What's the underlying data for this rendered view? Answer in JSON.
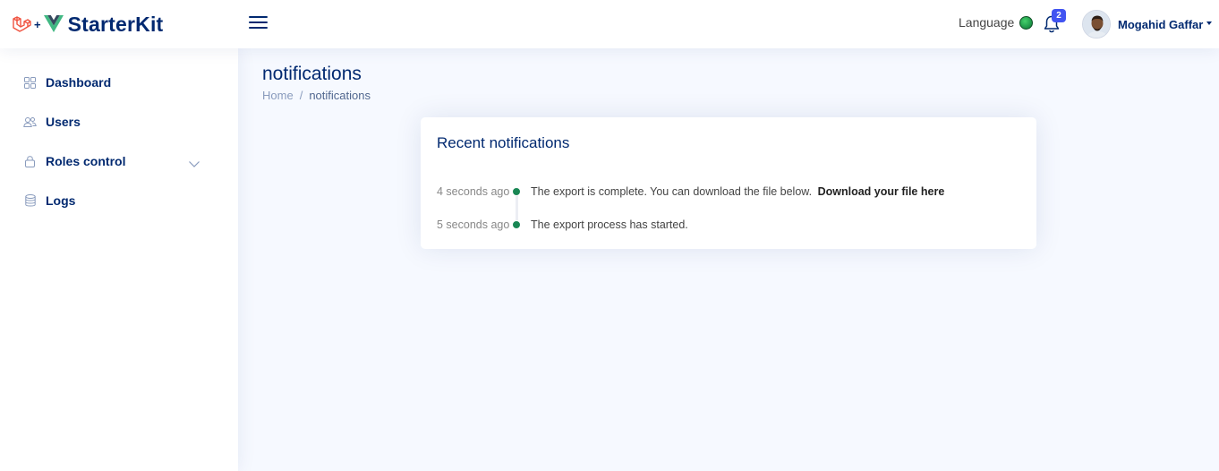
{
  "header": {
    "brand_plus": "+",
    "brand_name": "StarterKit",
    "language_label": "Language",
    "notification_count": "2",
    "user_name": "Mogahid Gaffar"
  },
  "sidebar": {
    "items": [
      {
        "label": "Dashboard",
        "icon": "grid-icon"
      },
      {
        "label": "Users",
        "icon": "people-icon"
      },
      {
        "label": "Roles control",
        "icon": "lock-icon"
      },
      {
        "label": "Logs",
        "icon": "database-icon"
      }
    ]
  },
  "main": {
    "title": "notifications",
    "breadcrumb": {
      "home": "Home",
      "separator": "/",
      "current": "notifications"
    },
    "card": {
      "title": "Recent notifications",
      "activities": [
        {
          "time": "4 seconds ago",
          "text": "The export is complete. You can download the file below.",
          "link": "Download your file here"
        },
        {
          "time": "5 seconds ago",
          "text": "The export process has started.",
          "link": ""
        }
      ]
    }
  },
  "colors": {
    "primary": "#012970",
    "accent": "#4154f1",
    "dot": "#198754",
    "background": "#f6f9ff",
    "laravel_red": "#f05340",
    "vue_green": "#41b883",
    "vue_dark": "#35495e"
  }
}
